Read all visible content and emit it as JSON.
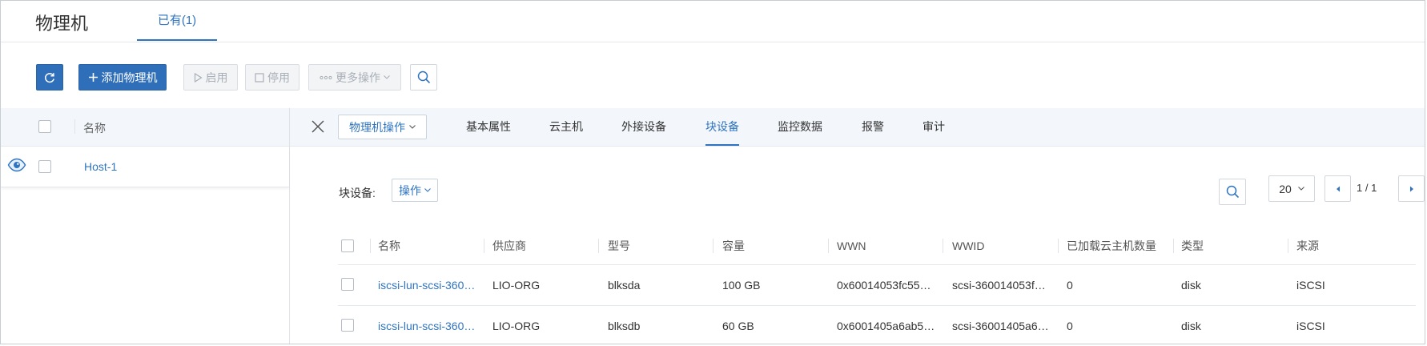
{
  "header": {
    "title": "物理机",
    "tab_label": "已有(1)"
  },
  "toolbar": {
    "add_label": "添加物理机",
    "enable_label": "启用",
    "disable_label": "停用",
    "more_label": "更多操作"
  },
  "list": {
    "column_name": "名称",
    "rows": [
      {
        "name": "Host-1"
      }
    ]
  },
  "detail": {
    "op_label": "物理机操作",
    "tabs": [
      "基本属性",
      "云主机",
      "外接设备",
      "块设备",
      "监控数据",
      "报警",
      "审计"
    ],
    "active_tab": "块设备",
    "section_label": "块设备:",
    "section_op_label": "操作",
    "pagination": {
      "page_size": "20",
      "page_text": "1 / 1"
    },
    "columns": [
      "名称",
      "供应商",
      "型号",
      "容量",
      "WWN",
      "WWID",
      "已加载云主机数量",
      "类型",
      "来源"
    ],
    "rows": [
      [
        "iscsi-lun-scsi-360…",
        "LIO-ORG",
        "blksda",
        "100 GB",
        "0x60014053fc55…",
        "scsi-360014053f…",
        "0",
        "disk",
        "iSCSI"
      ],
      [
        "iscsi-lun-scsi-360…",
        "LIO-ORG",
        "blksdb",
        "60 GB",
        "0x6001405a6ab5…",
        "scsi-36001405a6…",
        "0",
        "disk",
        "iSCSI"
      ]
    ]
  },
  "colors": {
    "accent": "#2f74c0",
    "primary_button": "#2f6fb9",
    "header_bg": "#f3f7fb"
  },
  "icons": [
    "refresh-icon",
    "plus-icon",
    "play-icon",
    "stop-icon",
    "dots-icon",
    "search-icon",
    "eye-icon",
    "close-icon",
    "chevron-down-icon",
    "prev-icon",
    "next-icon"
  ]
}
